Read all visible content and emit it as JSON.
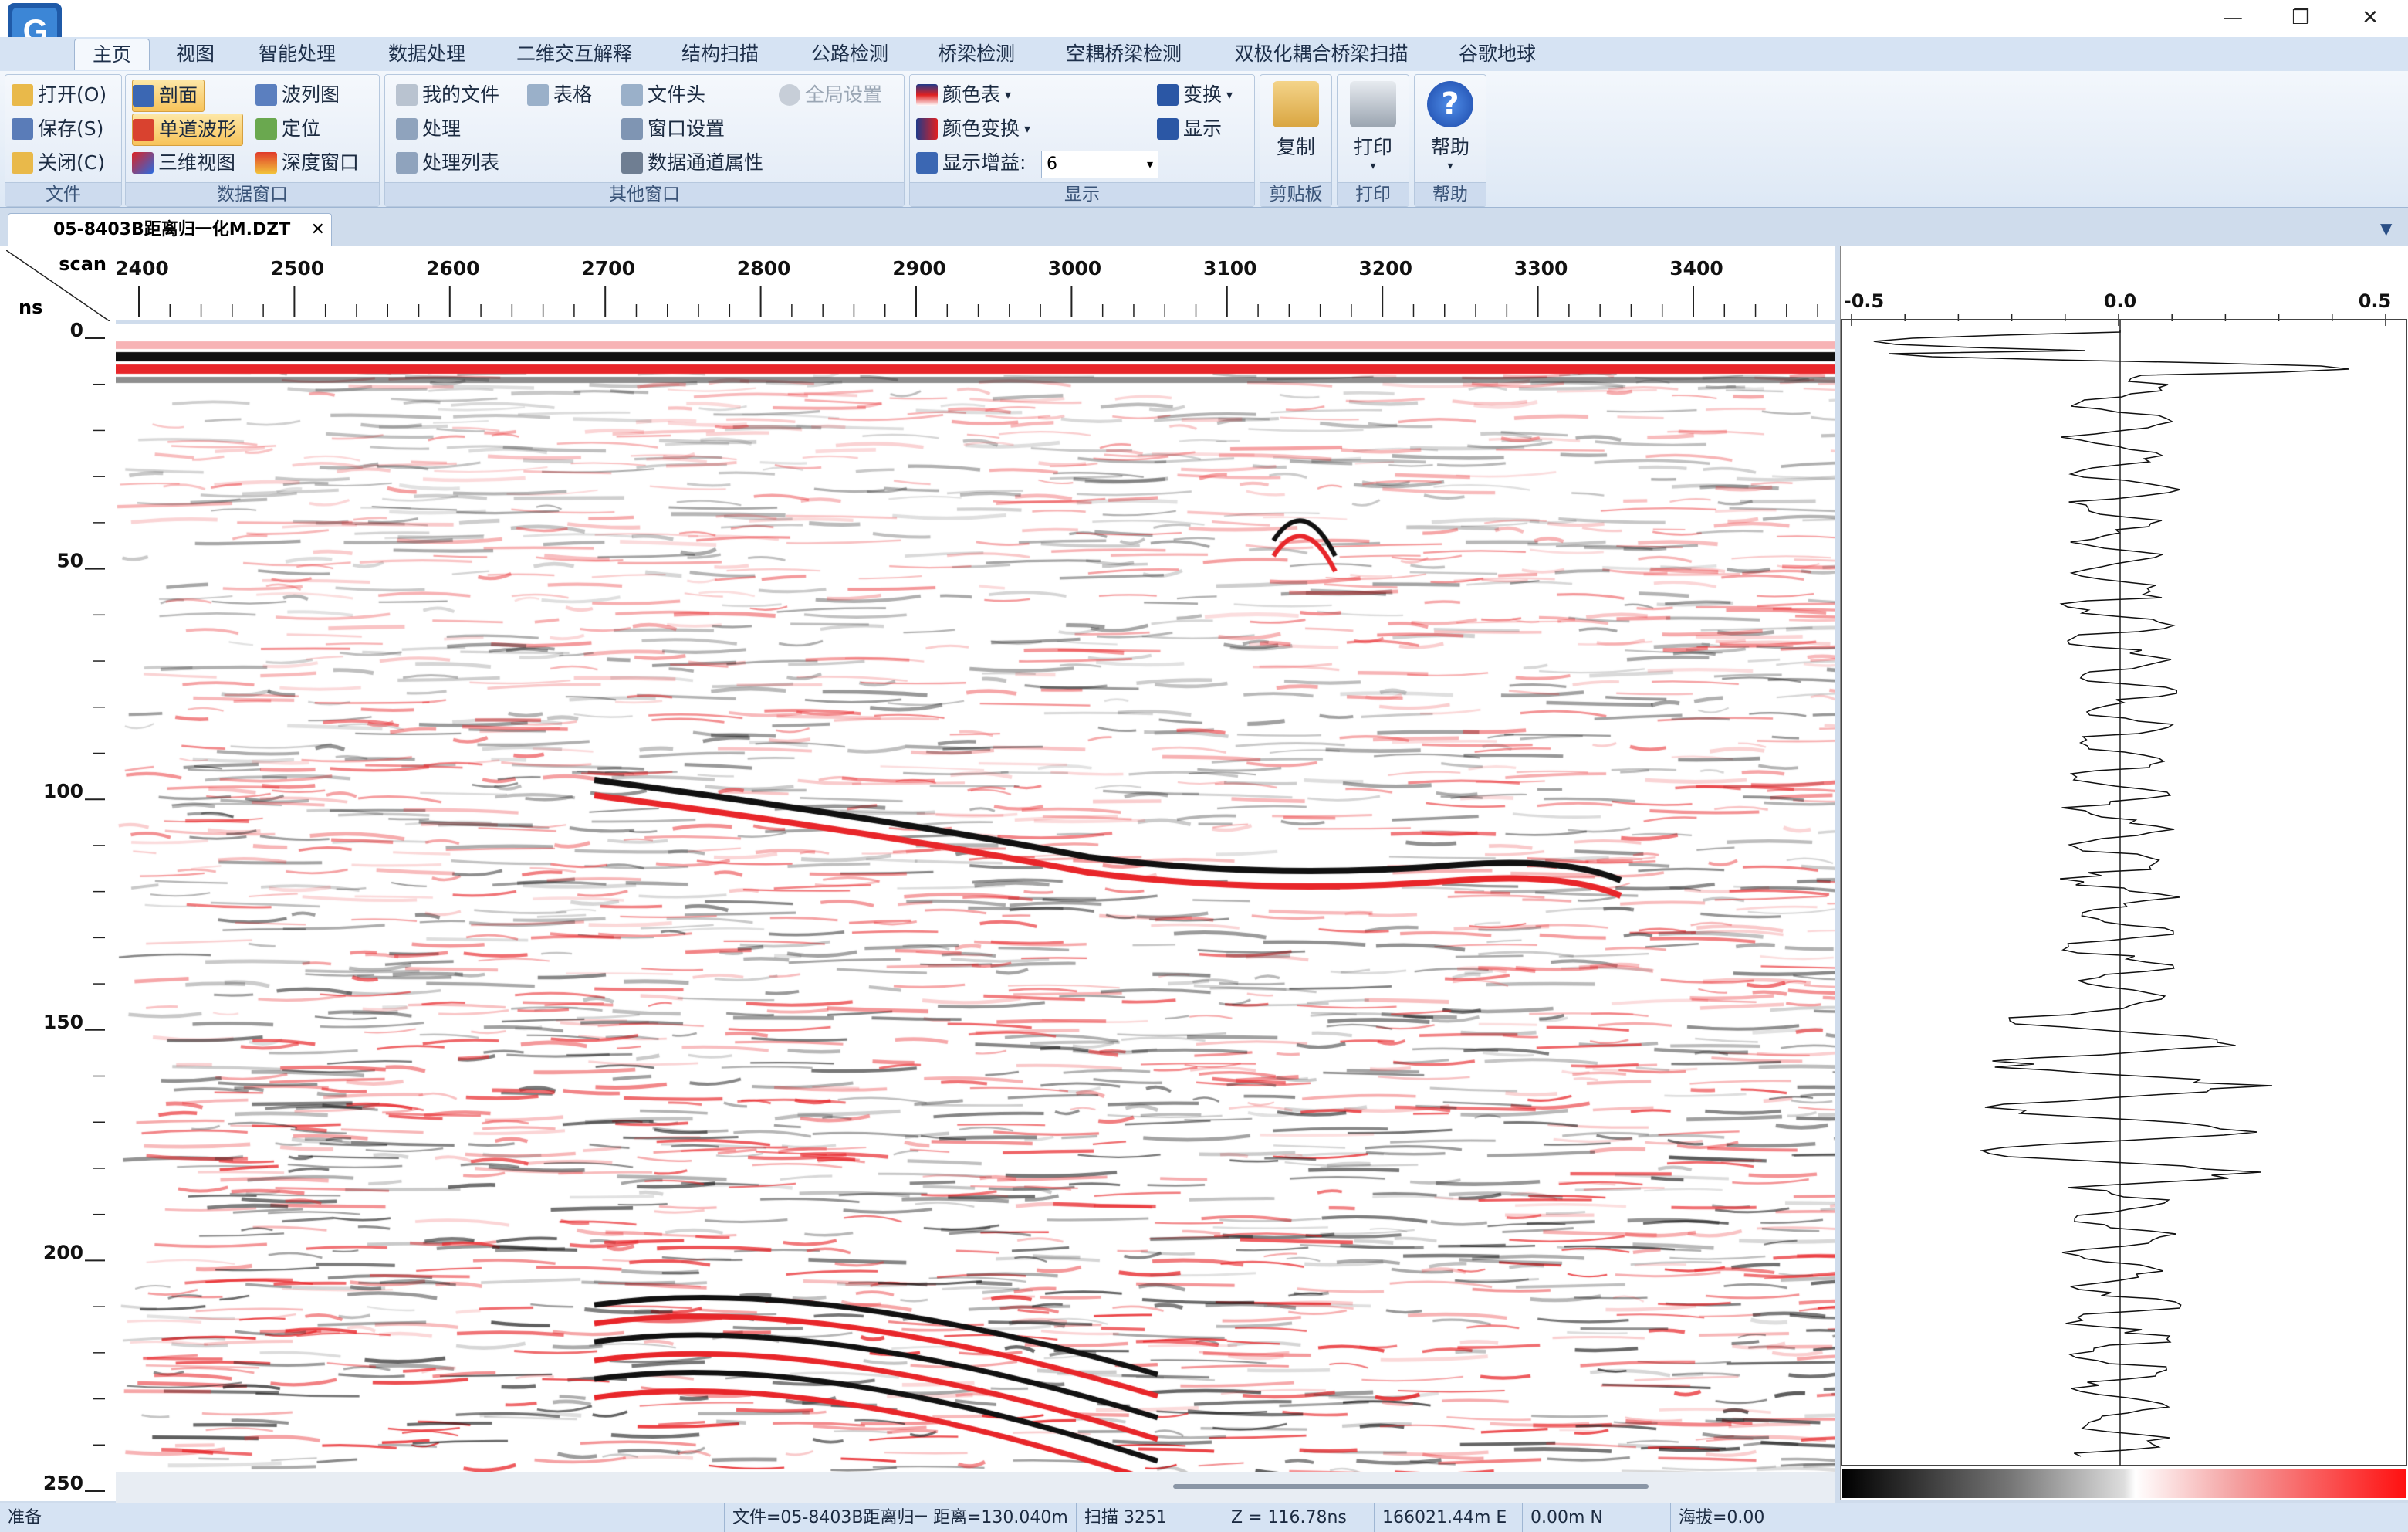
{
  "window": {
    "minimize": "—",
    "restore": "❐",
    "close": "✕"
  },
  "ribbon_tabs": [
    "主页",
    "视图",
    "智能处理",
    "数据处理",
    "二维交互解释",
    "结构扫描",
    "公路检测",
    "桥梁检测",
    "空耦桥梁检测",
    "双极化耦合桥梁扫描",
    "谷歌地球"
  ],
  "groups": {
    "file": {
      "label": "文件",
      "open": "打开(O)",
      "save": "保存(S)",
      "close": "关闭(C)"
    },
    "data_window": {
      "label": "数据窗口",
      "profile": "剖面",
      "single_trace": "单道波形",
      "3d": "三维视图",
      "wiggle": "波列图",
      "locate": "定位",
      "depth": "深度窗口"
    },
    "other_window": {
      "label": "其他窗口",
      "my_files": "我的文件",
      "process": "处理",
      "process_list": "处理列表",
      "table": "表格",
      "file_header": "文件头",
      "window_settings": "窗口设置",
      "data_channel": "数据通道属性",
      "global_settings": "全局设置"
    },
    "display": {
      "label": "显示",
      "color_table": "颜色表",
      "color_transform": "颜色变换",
      "display_gain": "显示增益:",
      "gain_value": "6",
      "transform": "变换",
      "show": "显示"
    },
    "clipboard": {
      "label": "剪贴板",
      "copy": "复制"
    },
    "print": {
      "label": "打印",
      "print": "打印"
    },
    "help": {
      "label": "帮助",
      "help": "帮助"
    }
  },
  "document_tab": {
    "title": "05-8403B距离归一化M.DZT",
    "close": "✕"
  },
  "profile": {
    "corner_top": "scan",
    "corner_bottom": "ns",
    "x_ticks": [
      "2400",
      "2500",
      "2600",
      "2700",
      "2800",
      "2900",
      "3000",
      "3100",
      "3200",
      "3300",
      "3400"
    ],
    "y_ticks": [
      "0",
      "50",
      "100",
      "150",
      "200",
      "250"
    ]
  },
  "trace": {
    "x_ticks": [
      "-0.5",
      "0.0",
      "0.5"
    ]
  },
  "status": {
    "ready": "准备",
    "file": "文件=05-8403B距离归一",
    "distance": "距离=130.040m",
    "scan": "扫描 3251",
    "z": "Z = 116.78ns",
    "easting": "166021.44m E",
    "northing": "0.00m N",
    "elevation": "海拔=0.00"
  },
  "colors": {
    "accent_red": "#e8262a",
    "ribbon_bg": "#dde8f5",
    "selected": "#f7c35a"
  }
}
